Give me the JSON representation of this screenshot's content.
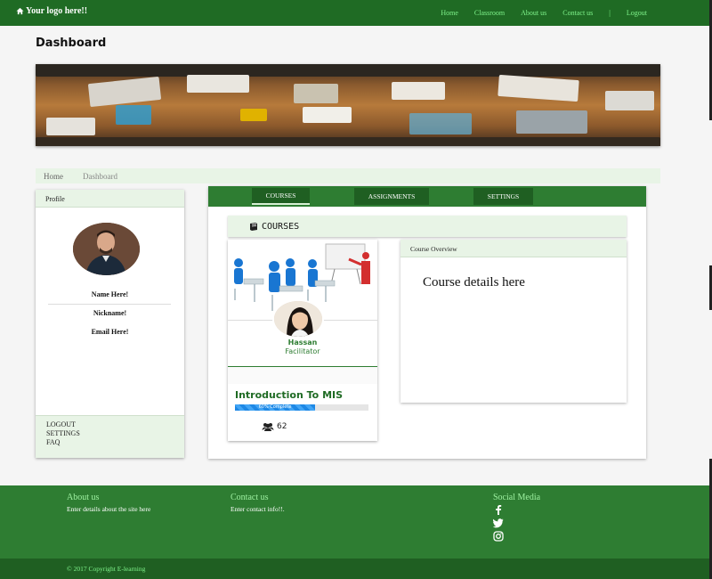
{
  "navbar": {
    "brand": "Your logo here!!",
    "links": [
      "Home",
      "Classroom",
      "About us",
      "Contact us"
    ],
    "separator": "|",
    "logout": "Logout"
  },
  "page": {
    "title": "Dashboard"
  },
  "breadcrumb": {
    "home": "Home",
    "current": "Dashboard"
  },
  "profile": {
    "header": "Profile",
    "name": "Name Here!",
    "nickname": "Nickname!",
    "email": "Email Here!",
    "links": {
      "logout": "LOGOUT",
      "settings": "SETTINGS",
      "faq": "FAQ"
    }
  },
  "tabs": {
    "courses": "COURSES",
    "assignments": "ASSIGNMENTS",
    "settings": "SETTINGS"
  },
  "courses": {
    "header": "COURSES",
    "card": {
      "facilitator_name": "Hassan",
      "facilitator_role": "Facilitator",
      "title": "Introduction To MIS",
      "progress_label": "60% Complete",
      "progress": 0.6,
      "enrolled": "62"
    },
    "overview": {
      "header": "Course Overview",
      "body": "Course details here"
    }
  },
  "footer": {
    "about_title": "About us",
    "about_text": "Enter details about the site here",
    "contact_title": "Contact us",
    "contact_text": "Enter contact info!!.",
    "social_title": "Social Media",
    "social_icons": [
      "facebook-icon",
      "twitter-icon",
      "instagram-icon"
    ],
    "copyright": "© 2017 Copyright E-learning"
  },
  "colors": {
    "primary": "#2e7d32",
    "dark": "#1f6b24",
    "accent": "#7ef28a",
    "panel": "#e8f4e6"
  }
}
